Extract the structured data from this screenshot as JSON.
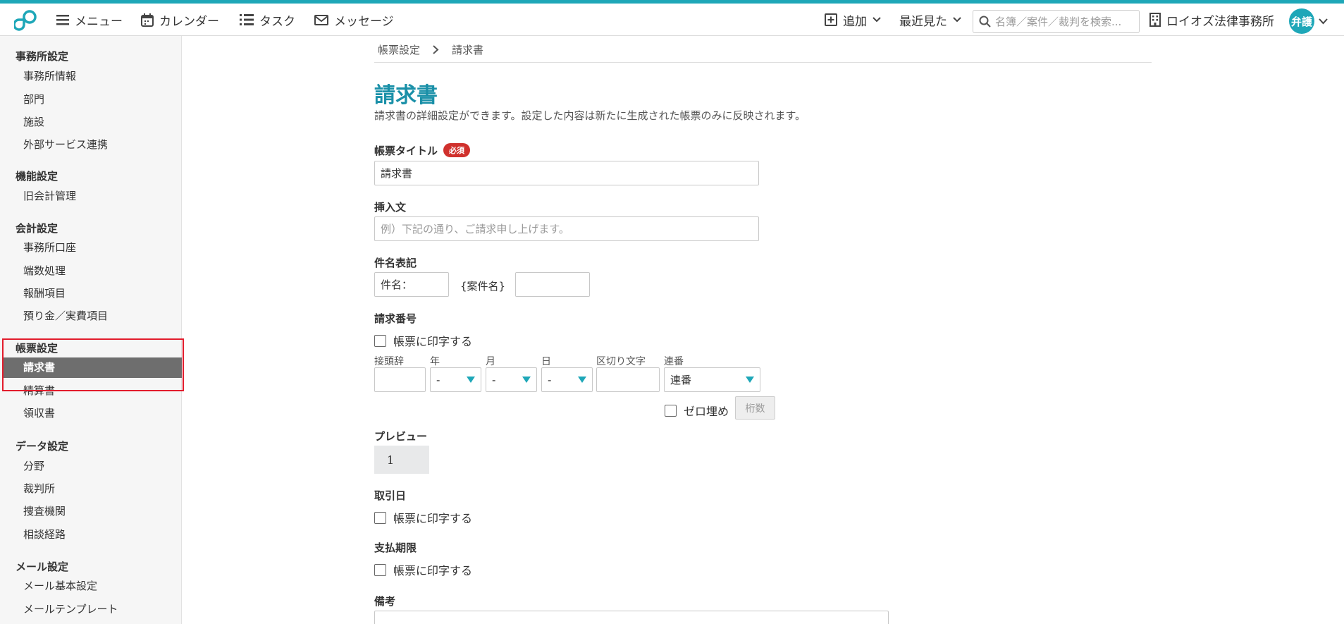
{
  "topbar": {
    "menu": "メニュー",
    "calendar": "カレンダー",
    "tasks": "タスク",
    "messages": "メッセージ",
    "add": "追加",
    "recent": "最近見た",
    "search_placeholder": "名簿／案件／裁判を検索...",
    "office": "ロイオズ法律事務所",
    "avatar_text": "弁護",
    "accent_color": "#1ea7b8"
  },
  "sidebar": {
    "groups": [
      {
        "title": "事務所設定",
        "items": [
          "事務所情報",
          "部門",
          "施設",
          "外部サービス連携"
        ]
      },
      {
        "title": "機能設定",
        "items": [
          "旧会計管理"
        ]
      },
      {
        "title": "会計設定",
        "items": [
          "事務所口座",
          "端数処理",
          "報酬項目",
          "預り金／実費項目"
        ]
      },
      {
        "title": "帳票設定",
        "items": [
          "請求書",
          "精算書",
          "領収書"
        ]
      },
      {
        "title": "データ設定",
        "items": [
          "分野",
          "裁判所",
          "捜査機関",
          "相談経路"
        ]
      },
      {
        "title": "メール設定",
        "items": [
          "メール基本設定",
          "メールテンプレート"
        ]
      }
    ],
    "active_item": "請求書"
  },
  "breadcrumb": {
    "parent": "帳票設定",
    "current": "請求書"
  },
  "page": {
    "title": "請求書",
    "description": "請求書の詳細設定ができます。設定した内容は新たに生成された帳票のみに反映されます。"
  },
  "form": {
    "doc_title_label": "帳票タイトル",
    "required_badge": "必須",
    "doc_title_value": "請求書",
    "insert_label": "挿入文",
    "insert_placeholder": "例）下記の通り、ご請求申し上げます。",
    "subject_label": "件名表記",
    "subject_prefix_value": "件名：",
    "subject_middle": "{案件名}",
    "subject_suffix_value": "",
    "invoice_no_label": "請求番号",
    "print_label": "帳票に印字する",
    "prefix_label": "接頭辞",
    "year_label": "年",
    "month_label": "月",
    "day_label": "日",
    "separator_label": "区切り文字",
    "serial_label": "連番",
    "year_value": "-",
    "month_value": "-",
    "day_value": "-",
    "serial_value": "連番",
    "zero_pad_label": "ゼロ埋め",
    "digits_label": "桁数",
    "preview_label": "プレビュー",
    "preview_value": "1",
    "trade_date_label": "取引日",
    "due_date_label": "支払期限",
    "remarks_label": "備考"
  }
}
